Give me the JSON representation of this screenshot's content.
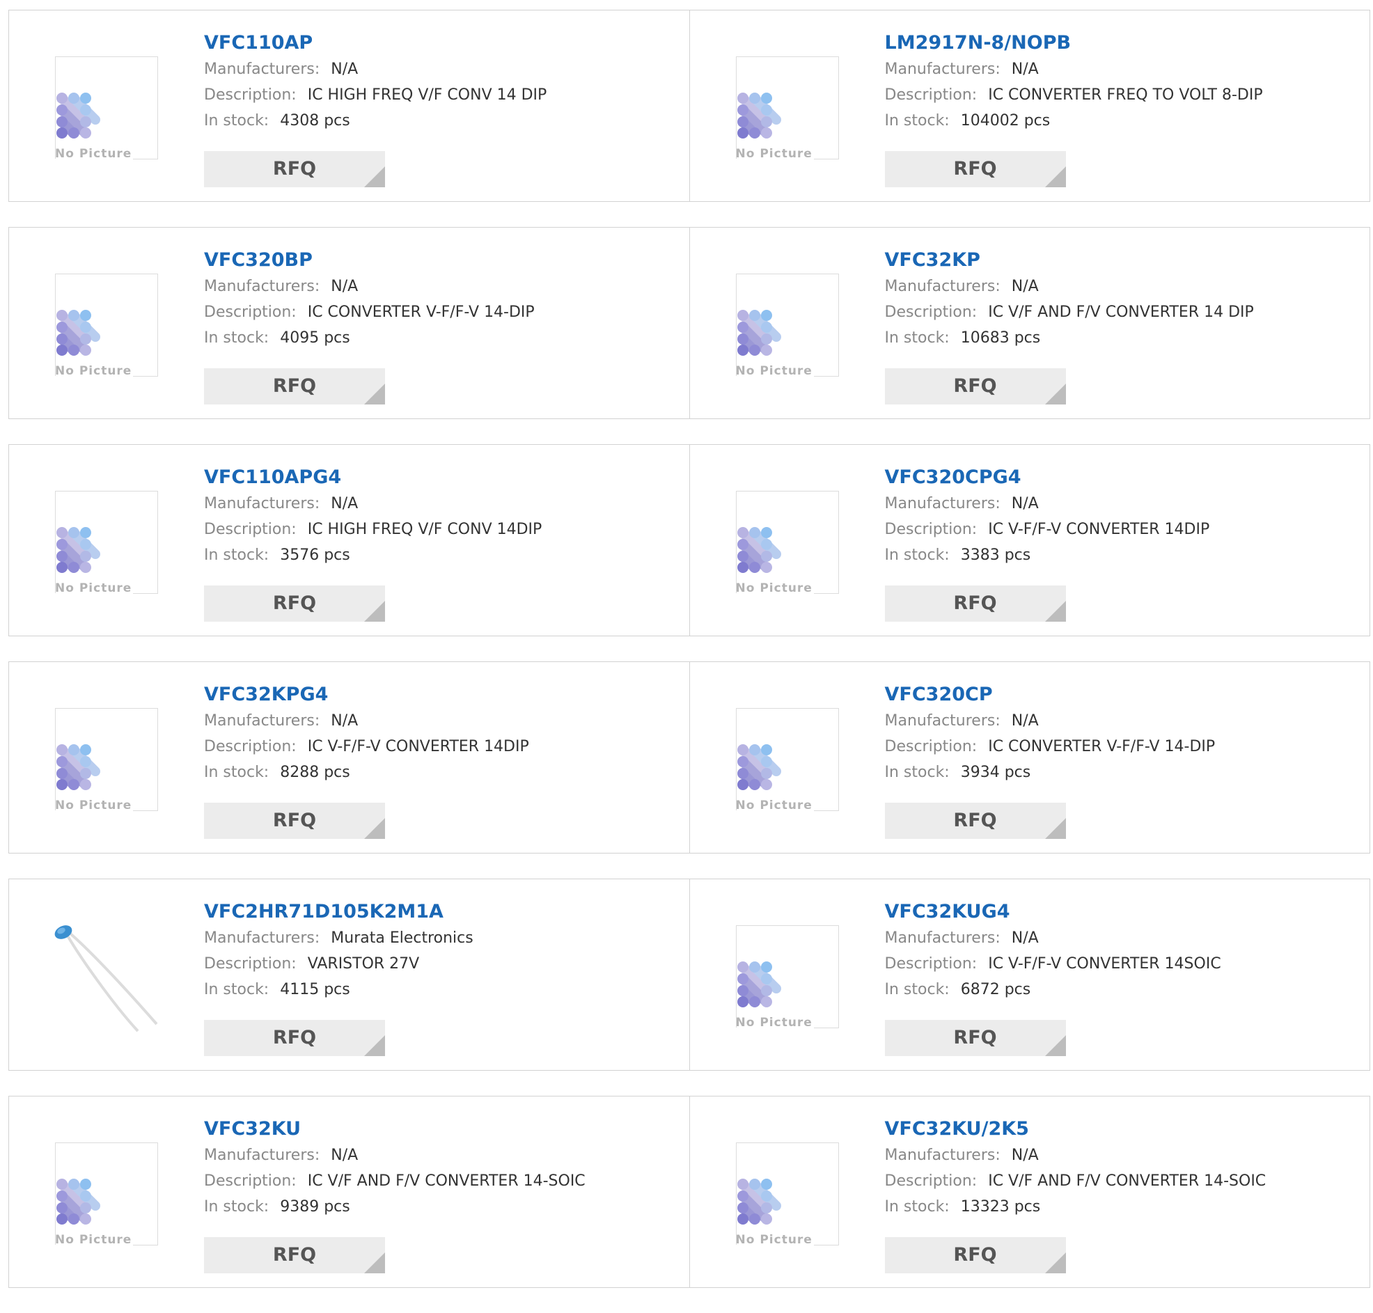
{
  "labels": {
    "manufacturers": "Manufacturers:",
    "description": "Description:",
    "in_stock": "In stock:",
    "rfq": "RFQ",
    "no_picture": "No Picture"
  },
  "colors": {
    "part_link": "#1a67b5",
    "label_gray": "#888888",
    "value_dark": "#333333",
    "rfq_bg": "#ececec"
  },
  "products": [
    {
      "part": "VFC110AP",
      "manufacturer": "N/A",
      "description": "IC HIGH FREQ V/F CONV 14 DIP",
      "stock": "4308 pcs",
      "image": "no-picture"
    },
    {
      "part": "LM2917N-8/NOPB",
      "manufacturer": "N/A",
      "description": "IC CONVERTER FREQ TO VOLT 8-DIP",
      "stock": "104002 pcs",
      "image": "no-picture"
    },
    {
      "part": "VFC320BP",
      "manufacturer": "N/A",
      "description": "IC CONVERTER V-F/F-V 14-DIP",
      "stock": "4095 pcs",
      "image": "no-picture"
    },
    {
      "part": "VFC32KP",
      "manufacturer": "N/A",
      "description": "IC V/F AND F/V CONVERTER 14 DIP",
      "stock": "10683 pcs",
      "image": "no-picture"
    },
    {
      "part": "VFC110APG4",
      "manufacturer": "N/A",
      "description": "IC HIGH FREQ V/F CONV 14DIP",
      "stock": "3576 pcs",
      "image": "no-picture"
    },
    {
      "part": "VFC320CPG4",
      "manufacturer": "N/A",
      "description": "IC V-F/F-V CONVERTER 14DIP",
      "stock": "3383 pcs",
      "image": "no-picture"
    },
    {
      "part": "VFC32KPG4",
      "manufacturer": "N/A",
      "description": "IC V-F/F-V CONVERTER 14DIP",
      "stock": "8288 pcs",
      "image": "no-picture"
    },
    {
      "part": "VFC320CP",
      "manufacturer": "N/A",
      "description": "IC CONVERTER V-F/F-V 14-DIP",
      "stock": "3934 pcs",
      "image": "no-picture"
    },
    {
      "part": "VFC2HR71D105K2M1A",
      "manufacturer": "Murata Electronics",
      "description": "VARISTOR 27V",
      "stock": "4115 pcs",
      "image": "varistor-photo"
    },
    {
      "part": "VFC32KUG4",
      "manufacturer": "N/A",
      "description": "IC V-F/F-V CONVERTER 14SOIC",
      "stock": "6872 pcs",
      "image": "no-picture"
    },
    {
      "part": "VFC32KU",
      "manufacturer": "N/A",
      "description": "IC V/F AND F/V CONVERTER 14-SOIC",
      "stock": "9389 pcs",
      "image": "no-picture"
    },
    {
      "part": "VFC32KU/2K5",
      "manufacturer": "N/A",
      "description": "IC V/F AND F/V CONVERTER 14-SOIC",
      "stock": "13323 pcs",
      "image": "no-picture"
    }
  ]
}
